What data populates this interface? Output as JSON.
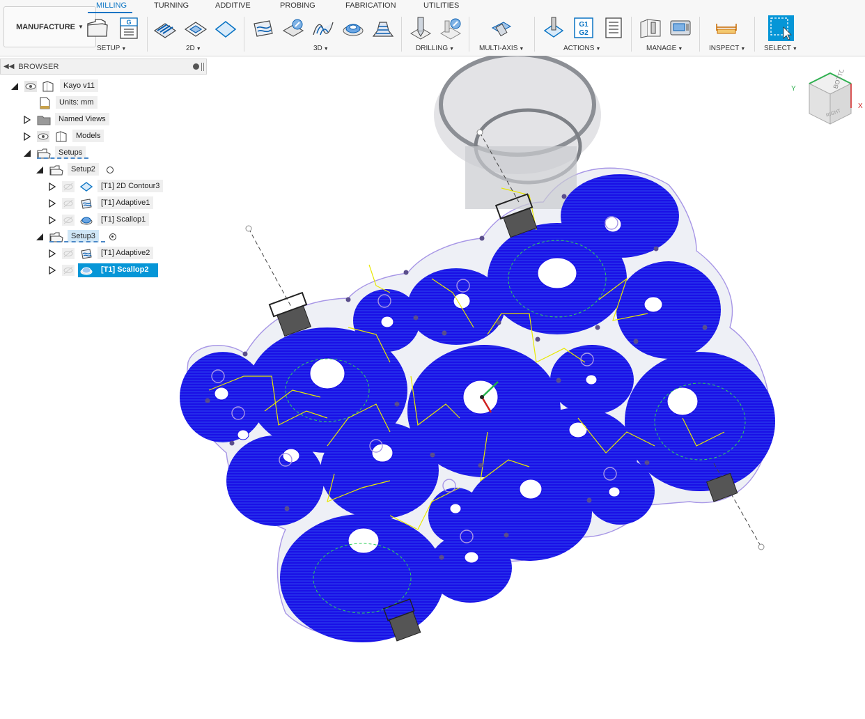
{
  "workspace": {
    "label": "MANUFACTURE"
  },
  "tabs": [
    "MILLING",
    "TURNING",
    "ADDITIVE",
    "PROBING",
    "FABRICATION",
    "UTILITIES"
  ],
  "active_tab": "MILLING",
  "groups": {
    "setup": "SETUP",
    "2d": "2D",
    "3d": "3D",
    "drilling": "DRILLING",
    "multiaxis": "MULTI-AXIS",
    "actions": "ACTIONS",
    "manage": "MANAGE",
    "inspect": "INSPECT",
    "select": "SELECT"
  },
  "actions_icon_text": [
    "G1",
    "G2"
  ],
  "browser": {
    "title": "BROWSER",
    "root": "Kayo v11",
    "units": "Units: mm",
    "named_views": "Named Views",
    "models": "Models",
    "setups": "Setups",
    "setup2": {
      "label": "Setup2",
      "operations": [
        "[T1] 2D Contour3",
        "[T1] Adaptive1",
        "[T1] Scallop1"
      ]
    },
    "setup3": {
      "label": "Setup3",
      "operations": [
        "[T1] Adaptive2",
        "[T1] Scallop2"
      ]
    },
    "selected": "[T1] Scallop2"
  },
  "viewcube": {
    "face_top": "BOTTOM",
    "face_side": "RIGHT",
    "axis_x": "X",
    "axis_y": "Y"
  },
  "colors": {
    "toolpath": "#1a10e6",
    "toolpath_dark": "#0c0aa8",
    "selection": "#0696d7",
    "active_tab": "#0a74c4",
    "feed_link": "#e8e800",
    "boundary": "#8f7ee0",
    "stock": "#e6e9ee"
  }
}
